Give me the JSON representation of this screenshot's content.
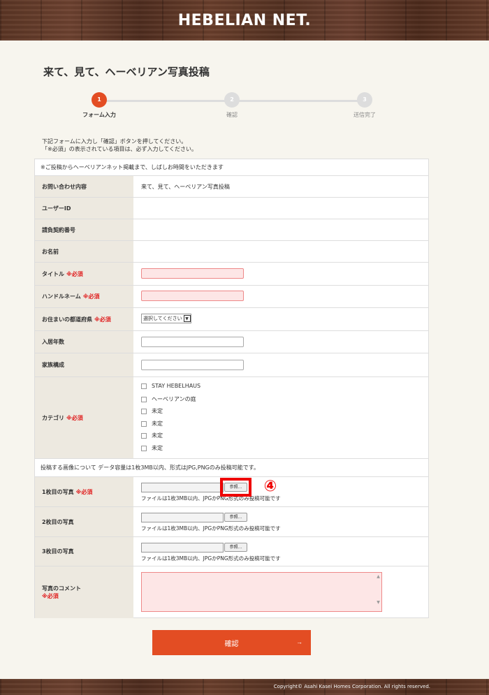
{
  "header": {
    "logo": "HEBELIAN NET."
  },
  "page_title": "来て、見て、ヘーベリアン写真投稿",
  "steps": [
    {
      "num": "1",
      "label": "フォーム入力",
      "active": true
    },
    {
      "num": "2",
      "label": "確認",
      "active": false
    },
    {
      "num": "3",
      "label": "送信完了",
      "active": false
    }
  ],
  "intro": {
    "line1": "下記フォームに入力し「確認」ボタンを押してください。",
    "line2": "「※必須」の表示されている項目は、必ず入力してください。"
  },
  "form": {
    "note_top": "※ご投稿からヘーベリアンネット掲載まで、しばしお時間をいただきます",
    "inquiry_label": "お問い合わせ内容",
    "inquiry_value": "来て、見て、ヘーベリアン写真投稿",
    "user_id_label": "ユーザーID",
    "contract_label": "請負契約番号",
    "name_label": "お名前",
    "title_label": "タイトル",
    "handle_label": "ハンドルネーム",
    "prefecture_label": "お住まいの都道府県",
    "prefecture_select": "選択してください",
    "years_label": "入居年数",
    "family_label": "家族構成",
    "category_label": "カテゴリ",
    "categories": [
      "STAY HEBELHAUS",
      "ヘーベリアンの庭",
      "未定",
      "未定",
      "未定",
      "未定"
    ],
    "required_mark": "※必須",
    "image_note": "投稿する画像について データ容量は1枚3MB以内、形式はJPG,PNGのみ投稿可能です。",
    "photo1_label": "1枚目の写真",
    "photo2_label": "2枚目の写真",
    "photo3_label": "3枚目の写真",
    "browse_label": "参照...",
    "file_note": "ファイルは1枚3MB以内、JPGかPNG形式のみ投稿可能です",
    "comment_label": "写真のコメント"
  },
  "annotation": {
    "badge": "④"
  },
  "confirm_button": {
    "label": "確認",
    "arrow": "→"
  },
  "footer": {
    "copyright": "Copyright© Asahi Kasei Homes Corporation. All rights reserved."
  },
  "colors": {
    "accent": "#e34d23",
    "required": "#e02020",
    "wood": "#5a3423"
  }
}
